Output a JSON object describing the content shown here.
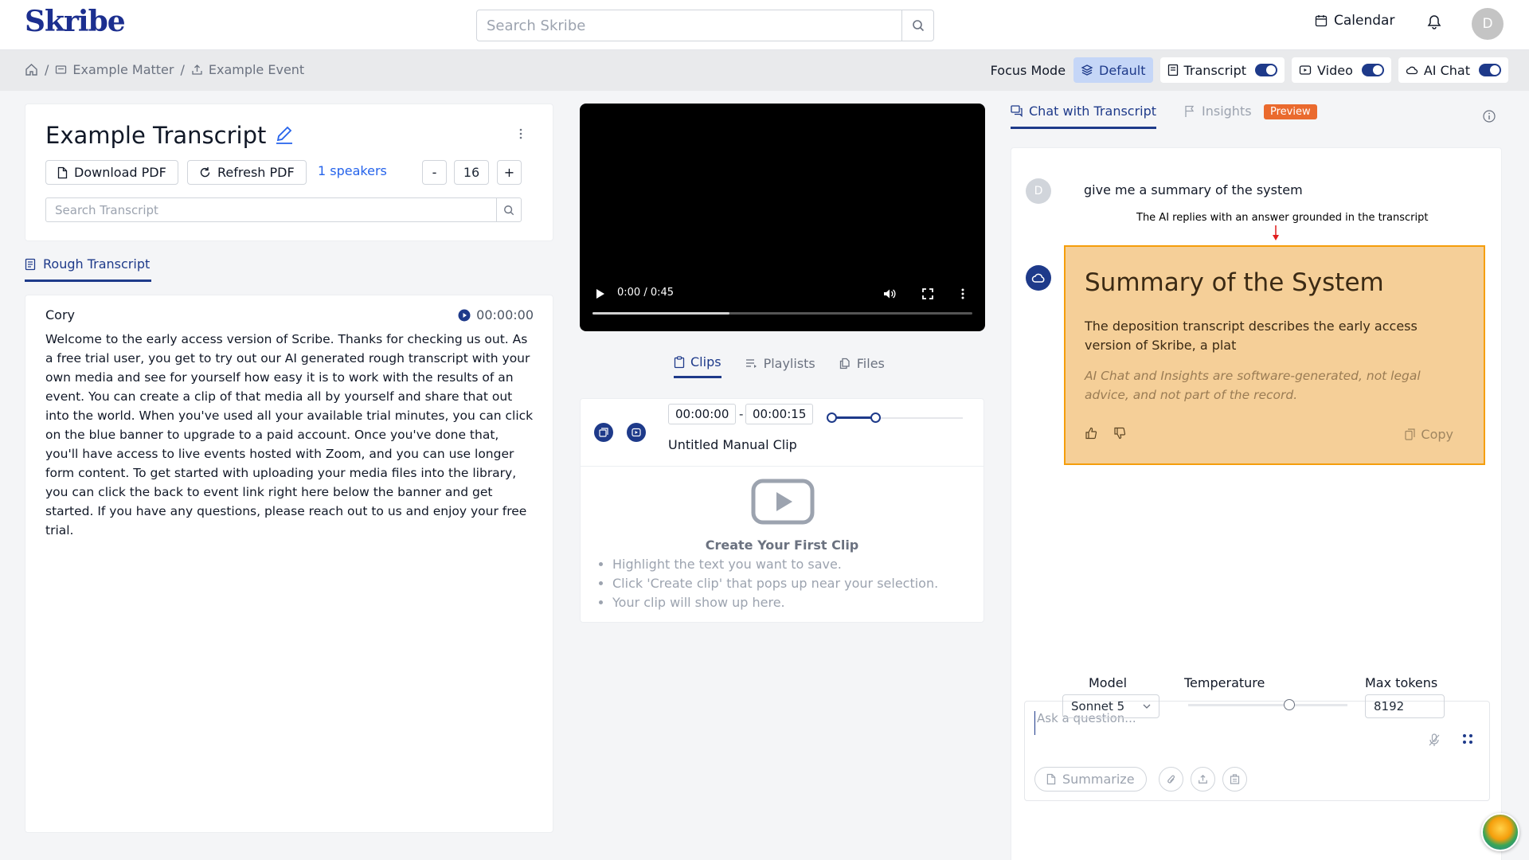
{
  "header": {
    "logo_text": "Skribe",
    "search_placeholder": "Search Skribe",
    "calendar_label": "Calendar",
    "avatar_initial": "D"
  },
  "breadcrumb": {
    "items": [
      {
        "label": "Example Matter",
        "icon": "matter-icon"
      },
      {
        "label": "Example Event",
        "icon": "upload-icon"
      }
    ],
    "separator": "/"
  },
  "focus_mode": {
    "label": "Focus Mode",
    "default_label": "Default",
    "toggles": [
      {
        "label": "Transcript",
        "on": true
      },
      {
        "label": "Video",
        "on": true
      },
      {
        "label": "AI Chat",
        "on": true
      }
    ]
  },
  "transcript": {
    "title": "Example Transcript",
    "download_label": "Download PDF",
    "refresh_label": "Refresh PDF",
    "speakers_label": "1 speakers",
    "font_size": "16",
    "minus_label": "-",
    "plus_label": "+",
    "search_placeholder": "Search Transcript",
    "tab_label": "Rough Transcript",
    "speaker": "Cory",
    "timestamp": "00:00:00",
    "text": "Welcome to the early access version of Scribe. Thanks for checking us out. As a free trial user, you get to try out our AI generated rough transcript with your own media and see for yourself how easy it is to work with the results of an event. You can create a clip of that media all by yourself and share that out into the world. When you've used all your available trial minutes, you can click on the blue banner to upgrade to a paid account. Once you've done that, you'll have access to live events hosted with Zoom, and you can use longer form content. To get started with uploading your media files into the library, you can click the back to event link right here below the banner and get started. If you have any questions, please reach out to us and enjoy your free trial."
  },
  "video": {
    "time": "0:00 / 0:45",
    "progress_percent": 36
  },
  "media_tabs": [
    {
      "label": "Clips",
      "active": true
    },
    {
      "label": "Playlists",
      "active": false
    },
    {
      "label": "Files",
      "active": false
    }
  ],
  "clip": {
    "start": "00:00:00",
    "end": "00:00:15",
    "separator": "-",
    "title": "Untitled Manual Clip",
    "empty_title": "Create Your First Clip",
    "steps": [
      "Highlight the text you want to save.",
      "Click 'Create clip' that pops up near your selection.",
      "Your clip will show up here."
    ]
  },
  "chat_tabs": {
    "chat_label": "Chat with Transcript",
    "insights_label": "Insights",
    "preview_badge": "Preview"
  },
  "chat": {
    "user_initial": "D",
    "user_message": "give me a summary of the system",
    "annotation": "The AI replies with an answer grounded in the transcript",
    "answer_heading": "Summary of the System",
    "answer_text": "The deposition transcript describes the early access version of Skribe, a plat",
    "disclaimer": "AI Chat and Insights are software-generated, not legal advice, and not part of the record.",
    "copy_label": "Copy",
    "ask_placeholder": "Ask a question...",
    "summarize_label": "Summarize"
  },
  "settings": {
    "model_label": "Model",
    "model_value": "Sonnet 5",
    "temperature_label": "Temperature",
    "max_tokens_label": "Max tokens",
    "max_tokens_value": "8192"
  },
  "colors": {
    "accent": "#1e3a8a",
    "answer_bg": "#f5cf98",
    "answer_border": "#f59e0b",
    "preview_badge": "#ea6a2e"
  }
}
